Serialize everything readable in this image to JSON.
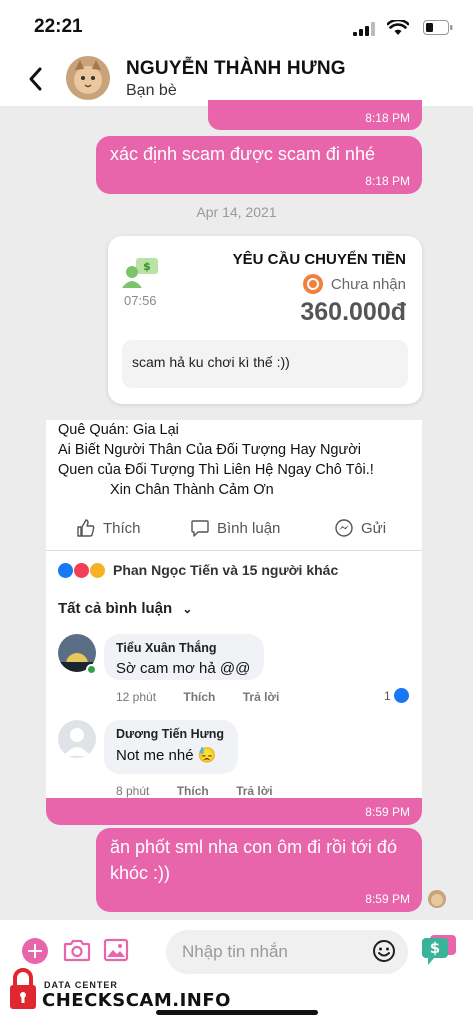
{
  "status_bar": {
    "time": "22:21"
  },
  "header": {
    "name": "NGUYỄN THÀNH HƯNG",
    "subtitle": "Bạn bè"
  },
  "messages": {
    "top_time": "8:18 PM",
    "msg2": {
      "text": "xác định scam được scam đi nhé",
      "time": "8:18 PM"
    },
    "date_separator": "Apr 14, 2021",
    "money_request": {
      "title": "YÊU CẦU CHUYỂN TIỀN",
      "status": "Chưa nhận",
      "amount": "360.000đ",
      "time": "07:56",
      "note": "scam hả ku chơi kì thế :))"
    },
    "screenshot": {
      "post_lines": [
        "Quê Quán: Gia Lại",
        "Ai Biết Người  Thân Của Đối Tượng Hay Người",
        "Quen của Đối Tượng Thì Liên Hệ Ngay Chô Tôi.!",
        "Xin Chân Thành Cảm Ơn"
      ],
      "actions": {
        "like": "Thích",
        "comment": "Bình luận",
        "share": "Gửi"
      },
      "reactions_text": "Phan Ngọc Tiến và 15 người khác",
      "all_comments": "Tất cả bình luận",
      "comments": [
        {
          "name": "Tiểu Xuân Thắng",
          "text": "Sờ cam mơ hả @@",
          "time": "12 phút",
          "like": "Thích",
          "reply": "Trả lời",
          "likes": "1"
        },
        {
          "name": "Dương Tiến Hưng",
          "text": "Not me nhé 😓",
          "time": "8 phút",
          "like": "Thích",
          "reply": "Trả lời"
        }
      ],
      "time": "8:59 PM"
    },
    "msg3": {
      "text": "ăn phốt sml nha con ôm đi rồi tới đó khóc :))",
      "time": "8:59 PM"
    }
  },
  "composer": {
    "placeholder": "Nhập tin nhắn"
  },
  "watermark": {
    "line1": "DATA CENTER",
    "line2": "CHECKSCAM.INFO"
  },
  "colors": {
    "bubble": "#e965ab",
    "accent": "#1877f2"
  }
}
